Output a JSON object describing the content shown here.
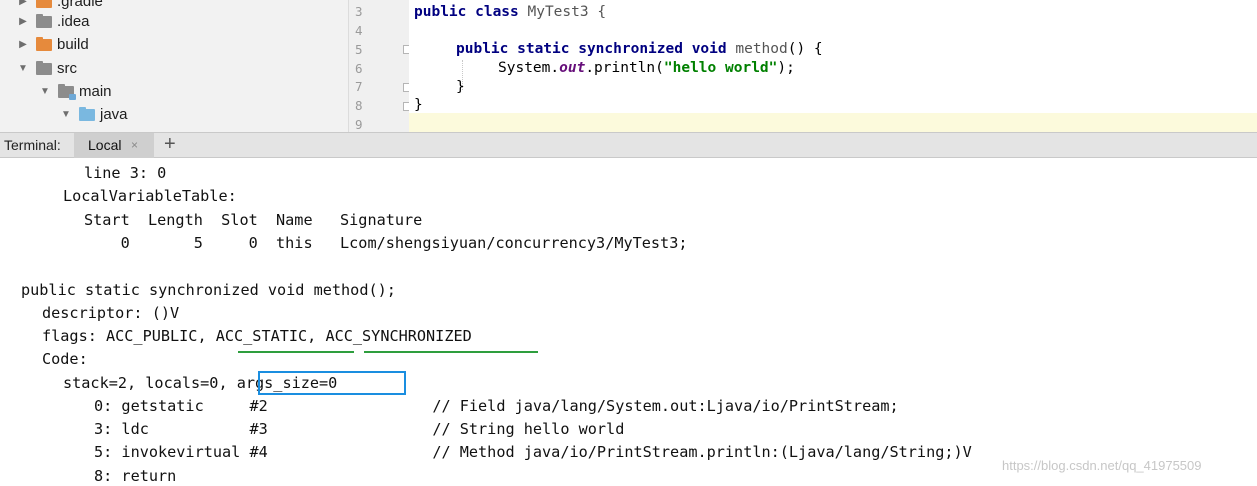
{
  "project_tree": {
    "items": [
      {
        "label": ".gradle",
        "arrow": "▶",
        "icon": "orange-folder-icon"
      },
      {
        "label": ".idea",
        "arrow": "▶",
        "icon": "gray-folder-icon"
      },
      {
        "label": "build",
        "arrow": "▶",
        "icon": "orange-folder-icon"
      },
      {
        "label": "src",
        "arrow": "▼",
        "icon": "gray-folder-icon"
      },
      {
        "label": "main",
        "arrow": "▼",
        "icon": "module-folder-icon"
      },
      {
        "label": "java",
        "arrow": "▼",
        "icon": "blue-source-folder-icon"
      }
    ]
  },
  "editor": {
    "line_numbers": [
      "3",
      "4",
      "5",
      "6",
      "7",
      "8",
      "9"
    ],
    "lines": [
      {
        "kw": "public class",
        "rest": " MyTest3 {"
      },
      {
        "kw": "public static synchronized void",
        "method": " method",
        "rest": "() {"
      },
      {
        "pre": "System.",
        "field": "out",
        "mid": ".println(",
        "str": "\"hello world\"",
        "post": ");"
      },
      {
        "text": "}"
      },
      {
        "text": "}"
      }
    ]
  },
  "terminal_bar": {
    "label": "Terminal:",
    "tab_label": "Local",
    "close": "×",
    "plus": "+"
  },
  "terminal": {
    "lines": [
      "line 3: 0",
      "LocalVariableTable:",
      "Start  Length  Slot  Name   Signature",
      "    0       5     0  this   Lcom/shengsiyuan/concurrency3/MyTest3;",
      "",
      "public static synchronized void method();",
      "descriptor: ()V",
      "flags: ACC_PUBLIC, ACC_STATIC, ACC_SYNCHRONIZED",
      "Code:",
      "stack=2, locals=0, args_size=0",
      "0: getstatic     #2                  // Field java/lang/System.out:Ljava/io/PrintStream;",
      "3: ldc           #3                  // String hello world",
      "5: invokevirtual #4                  // Method java/io/PrintStream.println:(Ljava/lang/String;)V",
      "8: return"
    ]
  },
  "watermark": "https://blog.csdn.net/qq_41975509",
  "colors": {
    "annotation_green": "#2e9e3e",
    "annotation_blue": "#1a8ee0"
  }
}
